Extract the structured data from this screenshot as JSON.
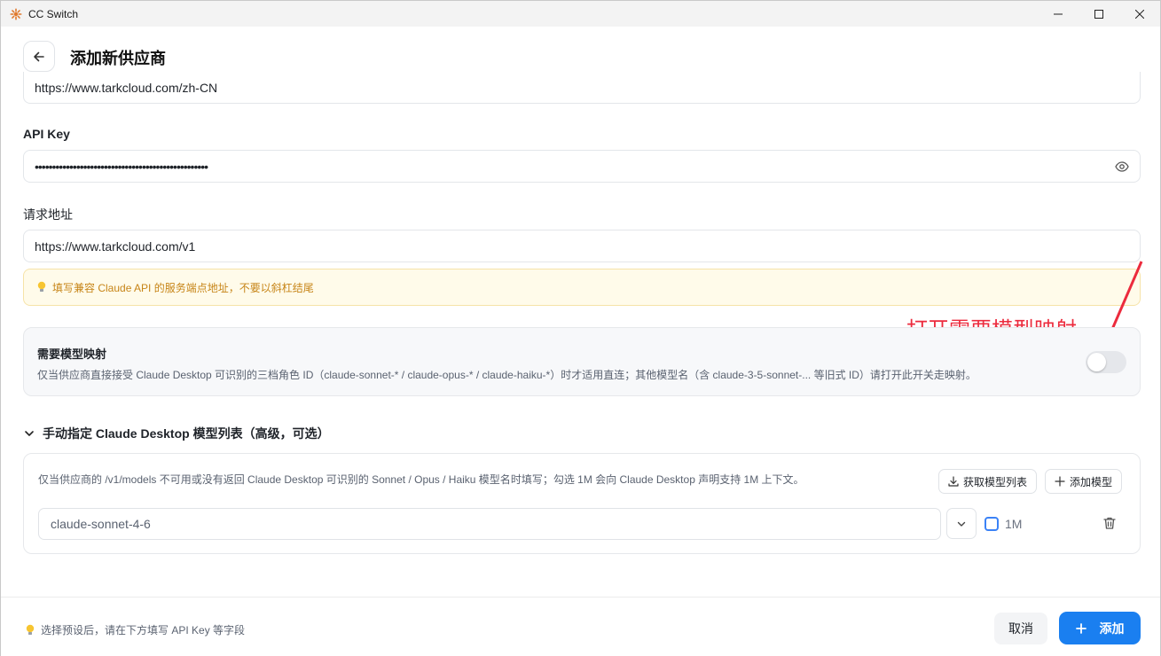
{
  "window": {
    "title": "CC Switch",
    "controls": [
      "minimize",
      "maximize",
      "close"
    ]
  },
  "header": {
    "title": "添加新供应商",
    "back_icon": "arrow-left-icon"
  },
  "form": {
    "website_url_value": "https://www.tarkcloud.com/zh-CN",
    "api_key_label": "API Key",
    "api_key_value": "••••••••••••••••••••••••••••••••••••••••••••••••••",
    "endpoint_label": "请求地址",
    "endpoint_value": "https://www.tarkcloud.com/v1",
    "endpoint_hint": "填写兼容 Claude API 的服务端点地址，不要以斜杠结尾"
  },
  "annotation": {
    "text": "打开需要模型映射",
    "color": "#ec2b3d"
  },
  "model_mapping": {
    "title": "需要模型映射",
    "description": "仅当供应商直接接受 Claude Desktop 可识别的三档角色 ID（claude-sonnet-* / claude-opus-* / claude-haiku-*）时才适用直连；其他模型名（含 claude-3-5-sonnet-... 等旧式 ID）请打开此开关走映射。",
    "enabled": false
  },
  "manual_models": {
    "section_title": "手动指定 Claude Desktop 模型列表（高级，可选）",
    "expanded": true,
    "description": "仅当供应商的 /v1/models 不可用或没有返回 Claude Desktop 可识别的 Sonnet / Opus / Haiku 模型名时填写；勾选 1M 会向 Claude Desktop 声明支持 1M 上下文。",
    "fetch_button": "获取模型列表",
    "add_button": "添加模型",
    "rows": [
      {
        "model": "claude-sonnet-4-6",
        "context_label": "1M",
        "context_checked": false
      }
    ]
  },
  "footer": {
    "hint": "选择预设后，请在下方填写 API Key 等字段",
    "cancel_button": "取消",
    "add_button": "添加"
  },
  "colors": {
    "accent": "#1a7ff0",
    "hint_text": "#c78518",
    "hint_bg": "#fffbea"
  }
}
